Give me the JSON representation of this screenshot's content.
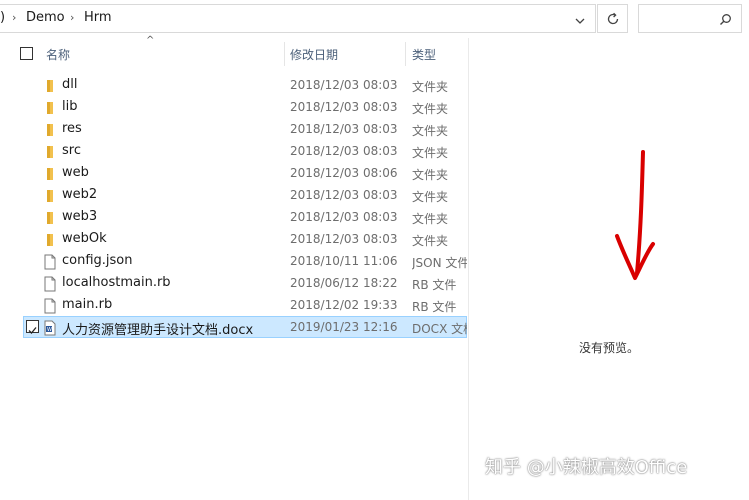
{
  "breadcrumb": {
    "truncated_left": ")",
    "items": [
      "Demo",
      "Hrm"
    ]
  },
  "search": {
    "placeholder": ""
  },
  "columns": {
    "name": "名称",
    "modified": "修改日期",
    "type": "类型"
  },
  "files": [
    {
      "name": "dll",
      "modified": "2018/12/03 08:03",
      "type": "文件夹",
      "icon": "folder-icon"
    },
    {
      "name": "lib",
      "modified": "2018/12/03 08:03",
      "type": "文件夹",
      "icon": "folder-icon"
    },
    {
      "name": "res",
      "modified": "2018/12/03 08:03",
      "type": "文件夹",
      "icon": "folder-icon"
    },
    {
      "name": "src",
      "modified": "2018/12/03 08:03",
      "type": "文件夹",
      "icon": "folder-icon"
    },
    {
      "name": "web",
      "modified": "2018/12/03 08:06",
      "type": "文件夹",
      "icon": "folder-icon"
    },
    {
      "name": "web2",
      "modified": "2018/12/03 08:03",
      "type": "文件夹",
      "icon": "folder-icon"
    },
    {
      "name": "web3",
      "modified": "2018/12/03 08:03",
      "type": "文件夹",
      "icon": "folder-icon"
    },
    {
      "name": "webOk",
      "modified": "2018/12/03 08:03",
      "type": "文件夹",
      "icon": "folder-icon"
    },
    {
      "name": "config.json",
      "modified": "2018/10/11 11:06",
      "type": "JSON 文件",
      "icon": "file-icon"
    },
    {
      "name": "localhostmain.rb",
      "modified": "2018/06/12 18:22",
      "type": "RB 文件",
      "icon": "file-icon"
    },
    {
      "name": "main.rb",
      "modified": "2018/12/02 19:33",
      "type": "RB 文件",
      "icon": "file-icon"
    },
    {
      "name": "人力资源管理助手设计文档.docx",
      "modified": "2019/01/23 12:16",
      "type": "DOCX 文档",
      "icon": "word-doc-icon",
      "selected": true
    }
  ],
  "preview": {
    "message": "没有预览。"
  },
  "watermark": "知乎 @小辣椒高效Office",
  "colors": {
    "folder": "#f2c14e",
    "selection_bg": "#cce8ff",
    "selection_border": "#99d1ff",
    "annotation_arrow": "#d90000",
    "header_text": "#4c607a"
  }
}
